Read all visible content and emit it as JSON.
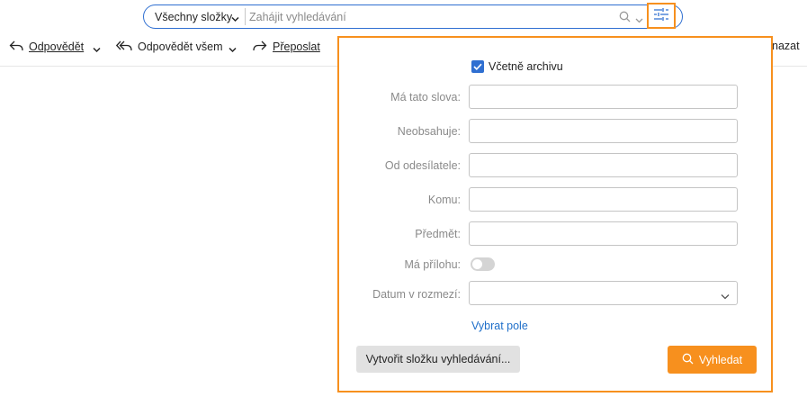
{
  "search": {
    "scope_label": "Všechny složky",
    "placeholder": "Zahájit vyhledávání",
    "value": ""
  },
  "toolbar": {
    "reply": "Odpovědět",
    "reply_all": "Odpovědět všem",
    "forward": "Přeposlat",
    "delete_partial": "nazat"
  },
  "advanced_search": {
    "include_archive_label": "Včetně archivu",
    "include_archive_checked": true,
    "fields": [
      {
        "label": "Má tato slova:",
        "value": ""
      },
      {
        "label": "Neobsahuje:",
        "value": ""
      },
      {
        "label": "Od odesílatele:",
        "value": ""
      },
      {
        "label": "Komu:",
        "value": ""
      },
      {
        "label": "Předmět:",
        "value": ""
      }
    ],
    "attachment_label": "Má přílohu:",
    "attachment_on": false,
    "date_label": "Datum v rozmezí:",
    "date_value": "",
    "choose_fields_link": "Vybrat pole",
    "create_folder_button": "Vytvořit složku vyhledávání...",
    "search_button": "Vyhledat"
  },
  "colors": {
    "accent": "#f7901e",
    "primary_blue": "#2f6fd1",
    "link": "#1f6fc9"
  }
}
